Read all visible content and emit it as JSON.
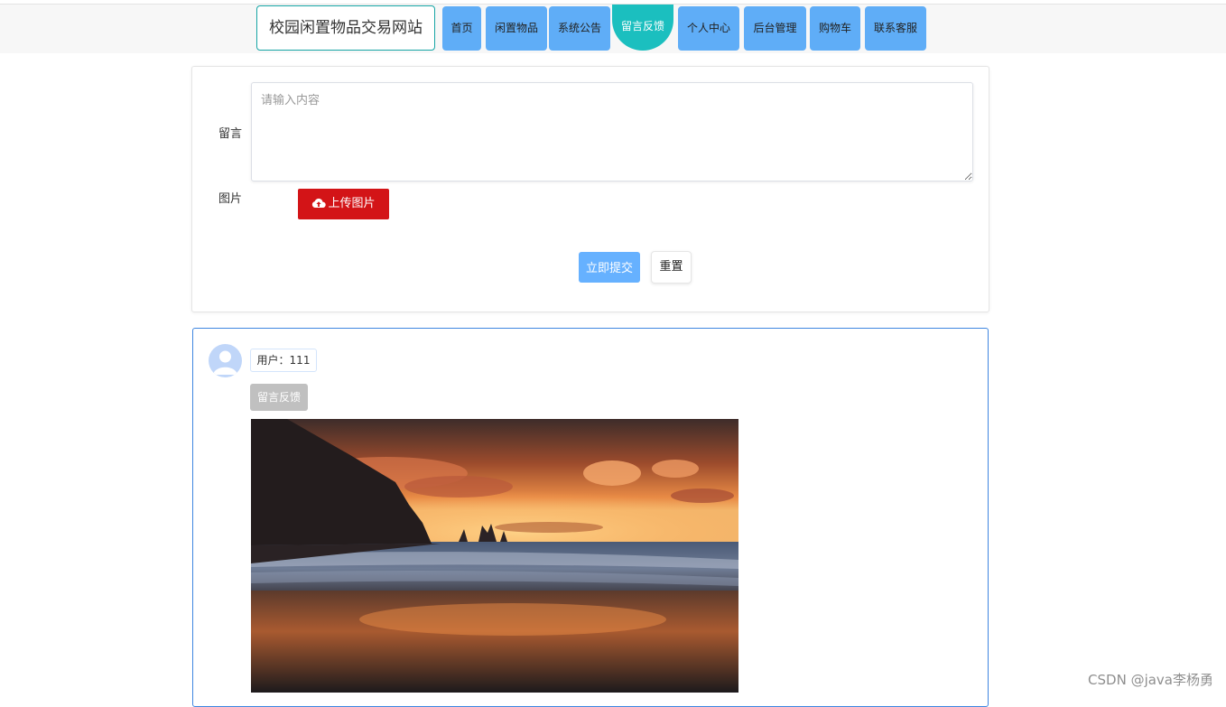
{
  "header": {
    "site_title": "校园闲置物品交易网站",
    "nav": [
      {
        "label": "首页"
      },
      {
        "label": "闲置物品"
      },
      {
        "label": "系统公告"
      },
      {
        "label": "留言反馈"
      },
      {
        "label": "个人中心"
      },
      {
        "label": "后台管理"
      },
      {
        "label": "购物车"
      },
      {
        "label": "联系客服"
      }
    ],
    "active": "留言反馈"
  },
  "form": {
    "message_label": "留言",
    "message_placeholder": "请输入内容",
    "message_value": "",
    "image_label": "图片",
    "upload_label": "上传图片",
    "submit_label": "立即提交",
    "reset_label": "重置"
  },
  "feedback_list": [
    {
      "user": "用户：111",
      "type_tag": "留言反馈",
      "image": "sunset-beach-photo"
    }
  ],
  "watermark": "CSDN @java李杨勇",
  "colors": {
    "nav_bg": "#5fadf7",
    "nav_active": "#1bbfbf",
    "upload": "#d31417",
    "submit": "#66b1ff",
    "card_border": "#3f86e0"
  }
}
